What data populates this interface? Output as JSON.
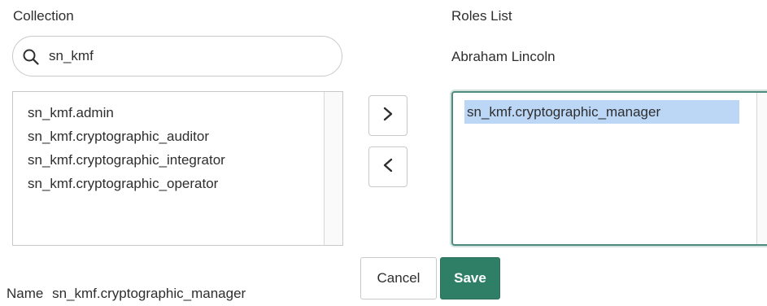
{
  "collection": {
    "label": "Collection",
    "search": {
      "value": "sn_kmf",
      "icon": "search-icon"
    },
    "items": [
      "sn_kmf.admin",
      "sn_kmf.cryptographic_auditor",
      "sn_kmf.cryptographic_integrator",
      "sn_kmf.cryptographic_operator"
    ]
  },
  "transfer": {
    "add_icon": "chevron-right-icon",
    "remove_icon": "chevron-left-icon"
  },
  "roles": {
    "label": "Roles List",
    "user": "Abraham Lincoln",
    "items": [
      "sn_kmf.cryptographic_manager"
    ],
    "selected_item": "sn_kmf.cryptographic_manager"
  },
  "actions": {
    "cancel_label": "Cancel",
    "save_label": "Save",
    "save_color": "#2f7f66"
  },
  "name_field": {
    "label": "Name",
    "value": "sn_kmf.cryptographic_manager"
  }
}
